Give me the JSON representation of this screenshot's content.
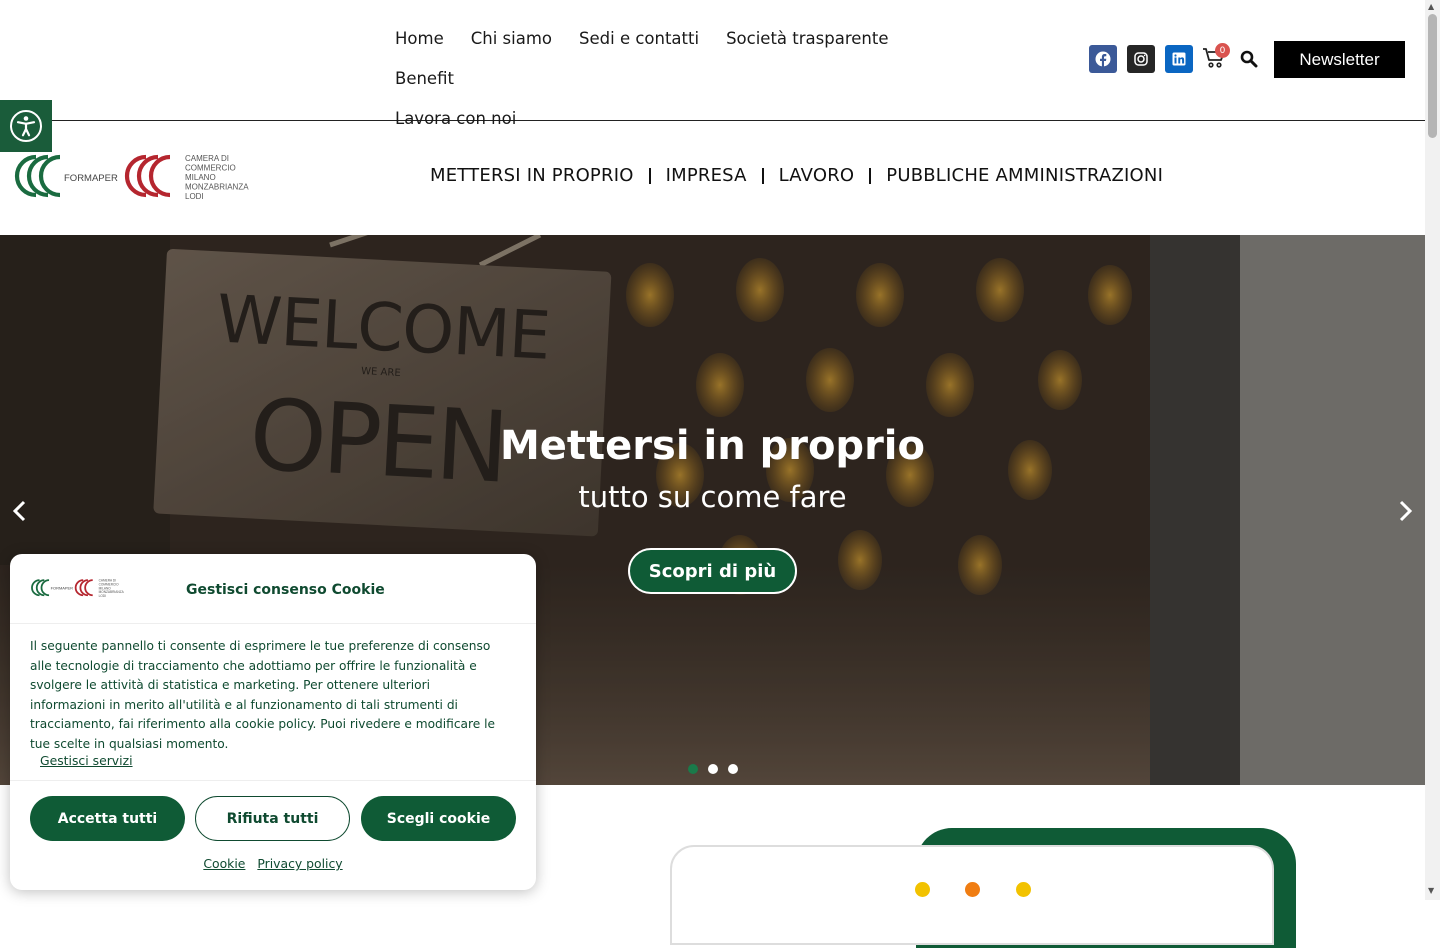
{
  "top_nav": {
    "items": [
      "Home",
      "Chi siamo",
      "Sedi e contatti",
      "Società trasparente",
      "Benefit",
      "Lavora con noi"
    ]
  },
  "header": {
    "cart_count": "0",
    "newsletter_label": "Newsletter"
  },
  "logo": {
    "brand": "FORMAPER",
    "chamber_lines": [
      "CAMERA DI",
      "COMMERCIO",
      "MILANO",
      "MONZABRIANZA",
      "LODI"
    ]
  },
  "main_nav": {
    "items": [
      "METTERSI IN PROPRIO",
      "IMPRESA",
      "LAVORO",
      "PUBBLICHE AMMINISTRAZIONI"
    ]
  },
  "hero": {
    "sign_top": "WELCOME",
    "sign_mid": "WE ARE",
    "sign_bottom": "OPEN",
    "title": "Mettersi in proprio",
    "subtitle": "tutto su come fare",
    "cta_label": "Scopri di più",
    "slides": 3,
    "active_slide": 1
  },
  "cookie": {
    "title": "Gestisci consenso Cookie",
    "text": "Il seguente pannello ti consente di esprimere le tue preferenze di consenso alle tecnologie di tracciamento che adottiamo per offrire le funzionalità e svolgere le attività di statistica e marketing. Per ottenere ulteriori informazioni in merito all'utilità e al funzionamento di tali strumenti di tracciamento, fai riferimento alla cookie policy. Puoi rivedere e modificare le tue scelte in qualsiasi momento.",
    "manage_label": "Gestisci servizi",
    "accept_label": "Accetta tutti",
    "reject_label": "Rifiuta tutti",
    "choose_label": "Scegli cookie",
    "link_cookie": "Cookie",
    "link_privacy": "Privacy policy"
  },
  "colors": {
    "brand_green": "#0f5b36",
    "brand_red": "#b5262f",
    "dot_yellow": "#f2c200",
    "dot_orange": "#f07d12"
  }
}
